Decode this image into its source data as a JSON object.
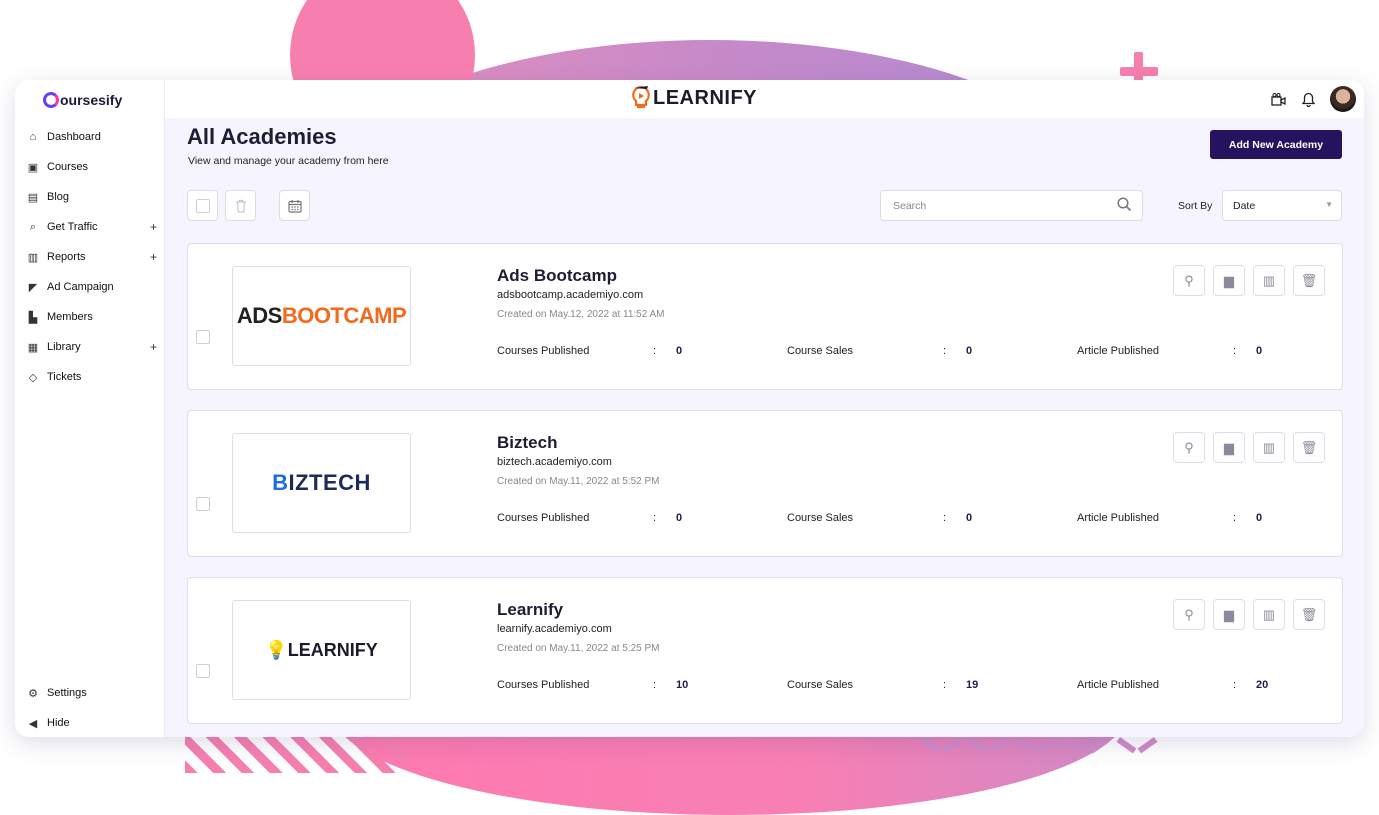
{
  "brand": {
    "name": "oursesify"
  },
  "app_logo": {
    "text": "LEARNIFY"
  },
  "sidebar": {
    "items": [
      {
        "label": "Dashboard",
        "icon": "home-icon",
        "expandable": false
      },
      {
        "label": "Courses",
        "icon": "box-icon",
        "expandable": false
      },
      {
        "label": "Blog",
        "icon": "newspaper-icon",
        "expandable": false
      },
      {
        "label": "Get Traffic",
        "icon": "search-traffic-icon",
        "expandable": true
      },
      {
        "label": "Reports",
        "icon": "bar-chart-icon",
        "expandable": true
      },
      {
        "label": "Ad Campaign",
        "icon": "megaphone-icon",
        "expandable": false
      },
      {
        "label": "Members",
        "icon": "person-icon",
        "expandable": false
      },
      {
        "label": "Library",
        "icon": "image-icon",
        "expandable": true
      },
      {
        "label": "Tickets",
        "icon": "ticket-icon",
        "expandable": false
      }
    ],
    "bottom": [
      {
        "label": "Settings",
        "icon": "gear-icon"
      },
      {
        "label": "Hide",
        "icon": "arrow-left-circle-icon"
      }
    ]
  },
  "header": {
    "title": "All Academies",
    "subtitle": "View and manage your academy from here",
    "add_button": "Add New Academy"
  },
  "toolbar": {
    "search_placeholder": "Search",
    "sort_label": "Sort By",
    "sort_value": "Date"
  },
  "academies": [
    {
      "name": "Ads Bootcamp",
      "url": "adsbootcamp.academiyo.com",
      "created": "Created on May.12, 2022 at 11:52 AM",
      "logo_text": [
        "ADS",
        "BOOTCAMP"
      ],
      "stats": [
        {
          "label": "Courses Published",
          "value": "0"
        },
        {
          "label": "Course Sales",
          "value": "0"
        },
        {
          "label": "Article Published",
          "value": "0"
        }
      ]
    },
    {
      "name": "Biztech",
      "url": "biztech.academiyo.com",
      "created": "Created on May.11, 2022 at 5:52 PM",
      "logo_text": [
        "B",
        "IZTECH"
      ],
      "stats": [
        {
          "label": "Courses Published",
          "value": "0"
        },
        {
          "label": "Course Sales",
          "value": "0"
        },
        {
          "label": "Article Published",
          "value": "0"
        }
      ]
    },
    {
      "name": "Learnify",
      "url": "learnify.academiyo.com",
      "created": "Created on May.11, 2022 at 5:25 PM",
      "logo_text": [
        "",
        "LEARNIFY"
      ],
      "stats": [
        {
          "label": "Courses Published",
          "value": "10"
        },
        {
          "label": "Course Sales",
          "value": "19"
        },
        {
          "label": "Article Published",
          "value": "20"
        }
      ]
    }
  ],
  "colors": {
    "primary": "#27125f",
    "accent_orange": "#f26a1b",
    "background": "#f6f4fe",
    "decor_pink": "#f77fb0"
  }
}
